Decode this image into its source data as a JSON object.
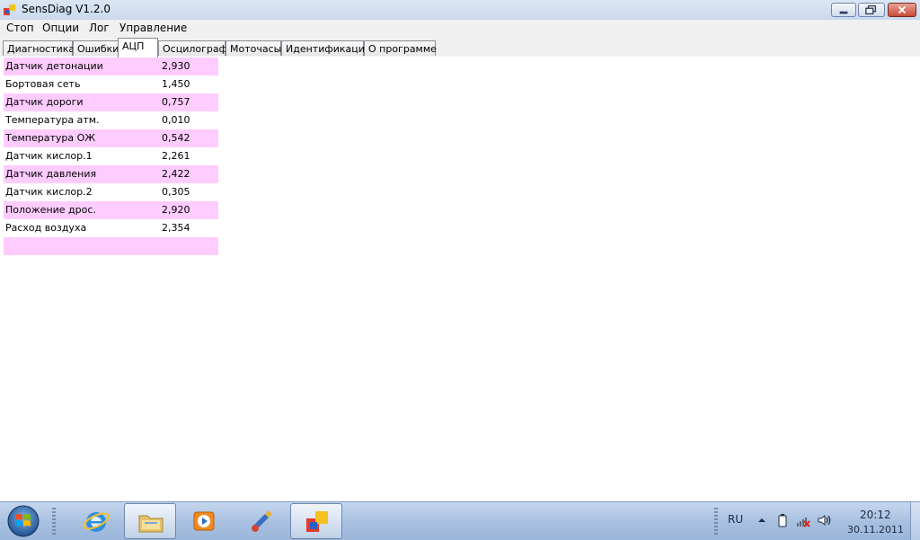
{
  "window": {
    "title": "SensDiag V1.2.0"
  },
  "menu": [
    {
      "label": "Стоп"
    },
    {
      "label": "Опции"
    },
    {
      "label": "Лог"
    },
    {
      "label": "Управление"
    }
  ],
  "tabs": [
    {
      "label": "Диагностика",
      "active": false
    },
    {
      "label": "Ошибки",
      "active": false
    },
    {
      "label": "АЦП",
      "active": true
    },
    {
      "label": "Осцилограф",
      "active": false
    },
    {
      "label": "Моточасы",
      "active": false
    },
    {
      "label": "Идентификация",
      "active": false
    },
    {
      "label": "О программе",
      "active": false
    }
  ],
  "adc_rows": [
    {
      "label": "Датчик детонации",
      "value": "2,930"
    },
    {
      "label": "Бортовая сеть",
      "value": "1,450"
    },
    {
      "label": "Датчик дороги",
      "value": "0,757"
    },
    {
      "label": "Температура атм.",
      "value": "0,010"
    },
    {
      "label": "Температура ОЖ",
      "value": "0,542"
    },
    {
      "label": "Датчик кислор.1",
      "value": "2,261"
    },
    {
      "label": "Датчик давления",
      "value": "2,422"
    },
    {
      "label": "Датчик кислор.2",
      "value": "0,305"
    },
    {
      "label": "Положение дрос.",
      "value": "2,920"
    },
    {
      "label": "Расход воздуха",
      "value": "2,354"
    },
    {
      "label": "",
      "value": ""
    }
  ],
  "colors": {
    "row_highlight": "#ffccff",
    "taskbar": "#a9c1e0"
  },
  "taskbar": {
    "items": [
      {
        "icon": "internet-explorer-icon"
      },
      {
        "icon": "file-explorer-icon"
      },
      {
        "icon": "media-player-icon"
      },
      {
        "icon": "paint-app-icon"
      },
      {
        "icon": "sensdiag-app-icon"
      }
    ],
    "language": "RU",
    "time": "20:12",
    "date": "30.11.2011"
  }
}
